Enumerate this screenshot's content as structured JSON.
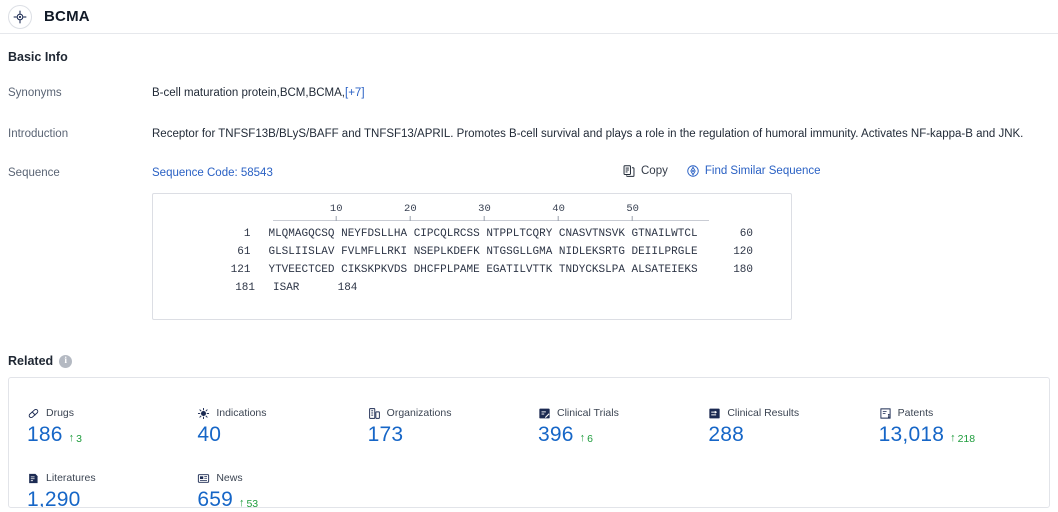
{
  "header": {
    "title": "BCMA",
    "icon": "target-icon"
  },
  "basic_info": {
    "section_title": "Basic Info",
    "synonyms_label": "Synonyms",
    "synonyms_value": "B-cell maturation protein,BCM,BCMA,",
    "synonyms_more": "[+7]",
    "introduction_label": "Introduction",
    "introduction_value": "Receptor for TNFSF13B/BLyS/BAFF and TNFSF13/APRIL. Promotes B-cell survival and plays a role in the regulation of humoral immunity. Activates NF-kappa-B and JNK.",
    "sequence_label": "Sequence",
    "sequence_code": "Sequence Code: 58543",
    "copy_label": "Copy",
    "find_similar_label": "Find Similar Sequence"
  },
  "sequence": {
    "ruler_ticks": [
      "10",
      "20",
      "30",
      "40",
      "50"
    ],
    "lines": [
      {
        "start": "1",
        "blocks": "MLQMAGQCSQ NEYFDSLLHA CIPCQLRCSS NTPPLTCQRY CNASVTNSVK GTNAILWTCL",
        "end": "60"
      },
      {
        "start": "61",
        "blocks": "GLSLIISLAV FVLMFLLRKI NSEPLKDEFK NTGSGLLGMA NIDLEKSRTG DEIILPRGLE",
        "end": "120"
      },
      {
        "start": "121",
        "blocks": "YTVEECTCED CIKSKPKVDS DHCFPLPAME EGATILVTTK TNDYCKSLPA ALSATEIEKS",
        "end": "180"
      },
      {
        "start": "181",
        "blocks": "ISAR",
        "end": "184"
      }
    ]
  },
  "related": {
    "title": "Related",
    "info_icon": "i",
    "cards": [
      {
        "icon": "pill-icon",
        "label": "Drugs",
        "value": "186",
        "delta": "3"
      },
      {
        "icon": "virus-icon",
        "label": "Indications",
        "value": "40",
        "delta": ""
      },
      {
        "icon": "organization-icon",
        "label": "Organizations",
        "value": "173",
        "delta": ""
      },
      {
        "icon": "clinical-trial-icon",
        "label": "Clinical Trials",
        "value": "396",
        "delta": "6"
      },
      {
        "icon": "clinical-result-icon",
        "label": "Clinical Results",
        "value": "288",
        "delta": ""
      },
      {
        "icon": "patent-icon",
        "label": "Patents",
        "value": "13,018",
        "delta": "218"
      },
      {
        "icon": "literature-icon",
        "label": "Literatures",
        "value": "1,290",
        "delta": ""
      },
      {
        "icon": "news-icon",
        "label": "News",
        "value": "659",
        "delta": "53"
      }
    ]
  },
  "colors": {
    "accent_blue": "#1666c7",
    "link_blue": "#2a61c4",
    "delta_green": "#1f9d3d",
    "icon_navy": "#1b2a52"
  }
}
